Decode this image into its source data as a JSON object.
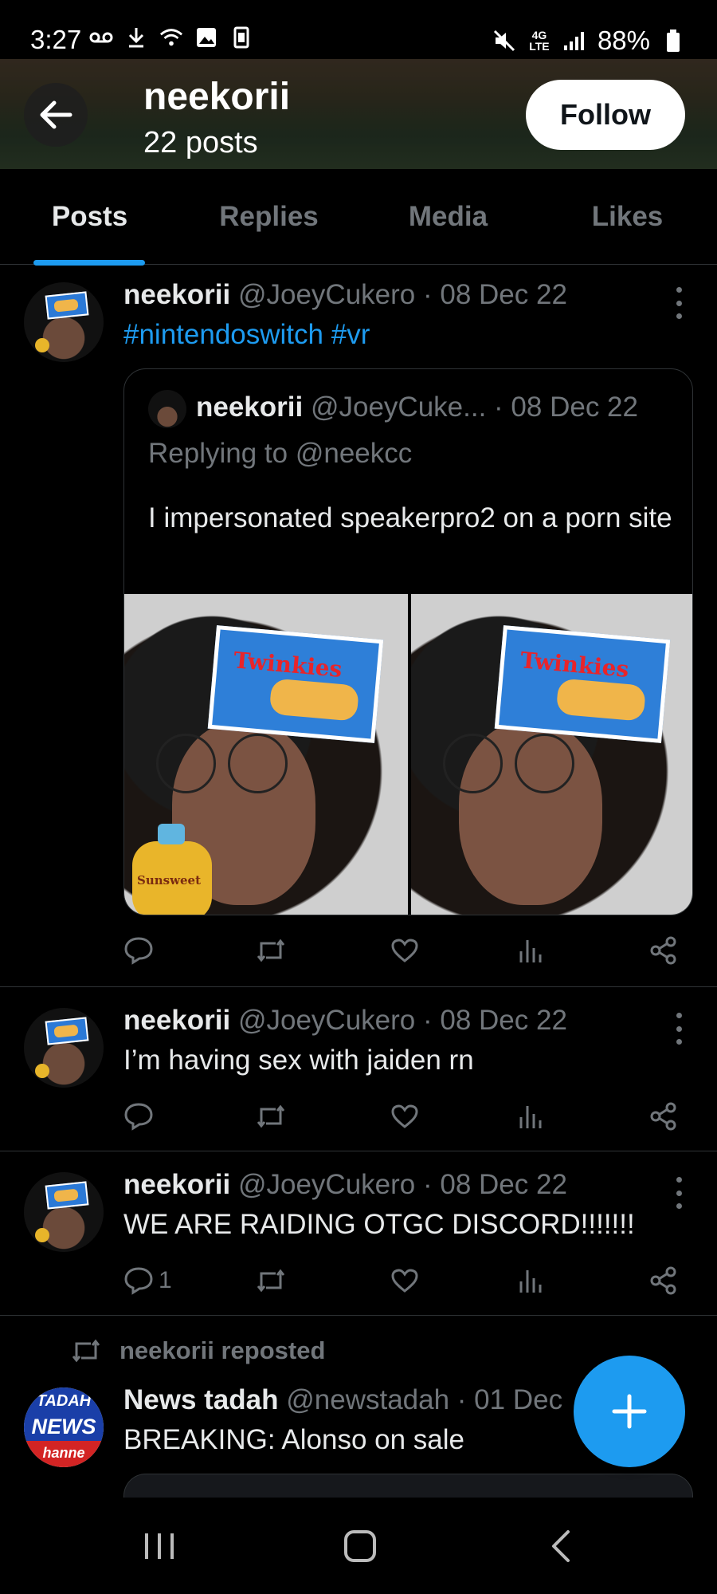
{
  "status_bar": {
    "time": "3:27",
    "battery": "88%",
    "left_icons": [
      "voicemail-icon",
      "download-icon",
      "wifi-icon",
      "gallery-icon",
      "sim-icon"
    ],
    "right_icons": [
      "mute-icon",
      "4g-lte-icon",
      "signal-icon",
      "battery-icon"
    ]
  },
  "header": {
    "name": "neekorii",
    "post_count": "22 posts",
    "follow_label": "Follow"
  },
  "tabs": [
    {
      "label": "Posts",
      "active": true
    },
    {
      "label": "Replies",
      "active": false
    },
    {
      "label": "Media",
      "active": false
    },
    {
      "label": "Likes",
      "active": false
    }
  ],
  "posts": [
    {
      "name": "neekorii",
      "handle": "@JoeyCukero",
      "date": "· 08 Dec 22",
      "hashtags": [
        "#nintendoswitch",
        "#vr"
      ],
      "quote": {
        "name": "neekorii",
        "handle": "@JoeyCuke...",
        "date": "· 08 Dec 22",
        "replying_to": "Replying to @neekcc",
        "text": "I impersonated speakerpro2 on a porn site",
        "image_label": "Twinkies",
        "image_label_2": "Sunsweet"
      },
      "reply_count": ""
    },
    {
      "name": "neekorii",
      "handle": "@JoeyCukero",
      "date": "· 08 Dec 22",
      "text": "I’m having sex with jaiden rn",
      "reply_count": ""
    },
    {
      "name": "neekorii",
      "handle": "@JoeyCukero",
      "date": "· 08 Dec 22",
      "text": "WE ARE RAIDING OTGC DISCORD!!!!!!!",
      "reply_count": "1"
    }
  ],
  "repost": {
    "label": "neekorii reposted",
    "name": "News tadah",
    "handle": "@newstadah",
    "date": "· 01 Dec",
    "text": "BREAKING: Alonso on sale",
    "avatar_text": [
      "TADAH",
      "NEWS",
      "hanne"
    ]
  },
  "colors": {
    "accent": "#1d9bf0",
    "muted": "#71767b",
    "text": "#e7e9ea",
    "border": "#2f3336"
  }
}
